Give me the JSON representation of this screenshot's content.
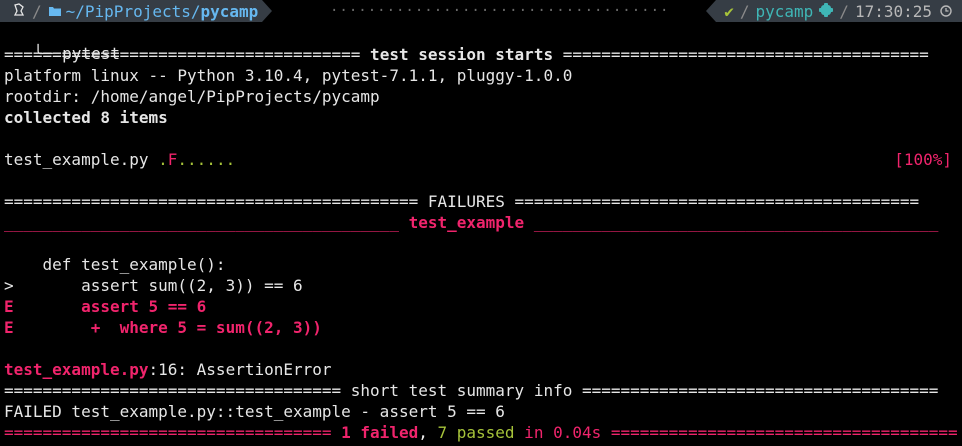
{
  "prompt": {
    "home_path": "~/PipProjects/",
    "current_dir": "pycamp",
    "status_check": "✔",
    "env_name": "pycamp",
    "time": "17:30:25",
    "dots": "···································································"
  },
  "command": "pytest",
  "session": {
    "header_left": "=====================================",
    "header_title": " test session starts ",
    "header_right": "======================================",
    "platform": "platform linux -- Python 3.10.4, pytest-7.1.1, pluggy-1.0.0",
    "rootdir": "rootdir: /home/angel/PipProjects/pycamp",
    "collected": "collected 8 items"
  },
  "progress": {
    "file": "test_example.py ",
    "dot1": ".",
    "fail": "F",
    "dots_rest": "......",
    "percent": "[100%]"
  },
  "failures": {
    "header_left": "===========================================",
    "header_title": " FAILURES ",
    "header_right": "==========================================",
    "test_left": "_________________________________________",
    "test_name": " test_example ",
    "test_right": "__________________________________________",
    "code_def": "    def test_example():",
    "code_assert_marker": ">",
    "code_assert": "       assert sum((2, 3)) == 6",
    "e1_marker": "E",
    "e1_text": "       assert 5 == 6",
    "e2_marker": "E",
    "e2_text": "        +  where 5 = sum((2, 3))",
    "location_file": "test_example.py",
    "location_rest": ":16: AssertionError"
  },
  "summary": {
    "header_left": "===================================",
    "header_title": " short test summary info ",
    "header_right": "=====================================",
    "failed_line": "FAILED test_example.py::test_example - assert 5 == 6",
    "final_left": "==================================",
    "final_failed": " 1 failed",
    "final_comma": ", ",
    "final_passed": "7 passed",
    "final_in": " in 0.04s ",
    "final_right": "===================================="
  },
  "colors": {
    "red": "#f0246c",
    "green": "#a6c33a",
    "blue": "#66b8f0",
    "bar": "#363d45"
  }
}
